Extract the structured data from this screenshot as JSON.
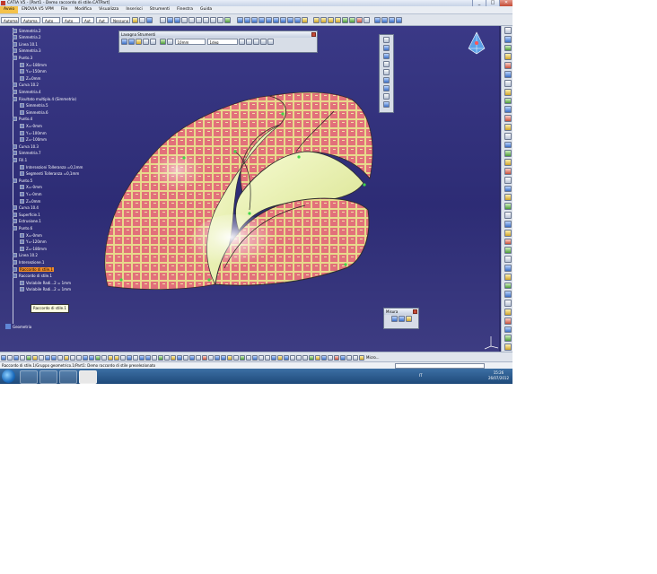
{
  "window": {
    "title": "CATIA V5 - [Part1 - Demo raccordo di stile.CATPart]",
    "controls": [
      "_",
      "□",
      "✕"
    ]
  },
  "menu": {
    "items": [
      "Avvio",
      "ENOVIA V5 VPM",
      "File",
      "Modifica",
      "Visualizza",
      "Inserisci",
      "Strumenti",
      "Finestra",
      "Guida"
    ],
    "active_index": 0
  },
  "toolbar": {
    "combos": [
      "Automa",
      "Automa",
      "Auto",
      "Auto",
      "Aut",
      "Aut",
      "Nessuno"
    ]
  },
  "tree": {
    "items": [
      {
        "label": "Simmetria.2"
      },
      {
        "label": "Simmetria.2"
      },
      {
        "label": "Linea 10.1"
      },
      {
        "label": "Simmetria.3"
      },
      {
        "label": "Punto.3"
      },
      {
        "label": "X=-180mm"
      },
      {
        "label": "Y=-150mm"
      },
      {
        "label": "Z=0mm"
      },
      {
        "label": "Curva 10.2"
      },
      {
        "label": "Simmetria.4"
      },
      {
        "label": "Risultato multiplo.4 (Simmetria)"
      },
      {
        "label": "Simmetria.5"
      },
      {
        "label": "Simmetria.6"
      },
      {
        "label": "Punto.4"
      },
      {
        "label": "X=-0mm"
      },
      {
        "label": "Y=-100mm"
      },
      {
        "label": "Z=-100mm"
      },
      {
        "label": "Curva 10.3"
      },
      {
        "label": "Simmetria.7"
      },
      {
        "label": "Fill.1"
      },
      {
        "label": "Intersezioni Tolleranza =0,1mm"
      },
      {
        "label": "Segmenti Tolleranza =0,1mm"
      },
      {
        "label": "Punto.5"
      },
      {
        "label": "X=-0mm"
      },
      {
        "label": "Y=-0mm"
      },
      {
        "label": "Z=0mm"
      },
      {
        "label": "Curva 10.4"
      },
      {
        "label": "Superficie.1"
      },
      {
        "label": "Estrusione.1"
      },
      {
        "label": "Punto.6"
      },
      {
        "label": "X=-0mm"
      },
      {
        "label": "Y=-120mm"
      },
      {
        "label": "Z=-180mm"
      },
      {
        "label": "Linea 10.2"
      },
      {
        "label": "Intersezione.1"
      },
      {
        "label": "Raccordo di stile.1"
      },
      {
        "label": "Raccordo di stile.1"
      },
      {
        "label": "Variabile Radi...2 = 1mm"
      },
      {
        "label": "Variabile Radi...2 = 1mm"
      }
    ],
    "highlighted_index": 35,
    "tooltip": "Raccordo di stile.1",
    "root_label": "Geometria"
  },
  "panels": {
    "laws": {
      "title": "Lavagna Strumenti",
      "combo1": "10mm",
      "combo2": "1deg"
    },
    "measure": {
      "title": "Misura"
    }
  },
  "bottom_toolbar": {
    "micro_label": "Micro..."
  },
  "status": {
    "text": "Raccordo di stile.1/Gruppo geometrico.1/Part1: Demo raccordo di stile preselezionato"
  },
  "taskbar": {
    "language": "IT",
    "time": "15:26",
    "date": "26/07/2012"
  },
  "colors": {
    "viewport_bg": "#2d2c75",
    "surface_red": "#e06a6a",
    "surface_cream": "#e6df8a",
    "inner_surface": "#eef5c0",
    "highlight": "#f08c2a"
  }
}
